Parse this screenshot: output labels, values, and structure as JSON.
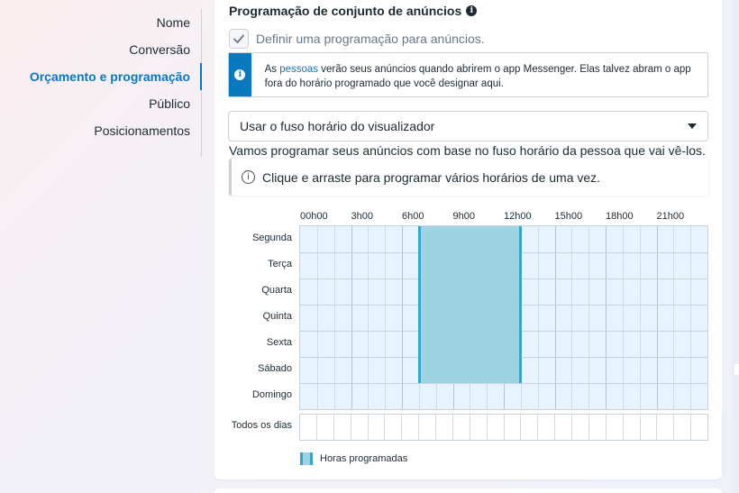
{
  "sidebar": {
    "items": [
      {
        "label": "Nome"
      },
      {
        "label": "Conversão"
      },
      {
        "label": "Orçamento e programação",
        "active": true
      },
      {
        "label": "Público"
      },
      {
        "label": "Posicionamentos"
      }
    ]
  },
  "section": {
    "title": "Programação de conjunto de anúncios",
    "checkbox_label": "Definir uma programação para anúncios.",
    "checkbox_checked": true
  },
  "notice": {
    "prefix": "As ",
    "link": "pessoas",
    "suffix": " verão seus anúncios quando abrirem o app Messenger. Elas talvez abram o app fora do horário programado que você designar aqui."
  },
  "timezone_select": {
    "value": "Usar o fuso horário do visualizador"
  },
  "description": "Vamos programar seus anúncios com base no fuso horário da pessoa que vai vê-los.",
  "hint": "Clique e arraste para programar vários horários de uma vez.",
  "schedule": {
    "hour_labels": [
      "00h00",
      "3h00",
      "6h00",
      "9h00",
      "12h00",
      "15h00",
      "18h00",
      "21h00"
    ],
    "days": [
      "Segunda",
      "Terça",
      "Quarta",
      "Quinta",
      "Sexta",
      "Sábado",
      "Domingo"
    ],
    "all_days_label": "Todos os dias",
    "legend_label": "Horas programadas",
    "scheduled_start_hour": 7,
    "scheduled_end_hour": 13,
    "scheduled_days": [
      "Segunda",
      "Terça",
      "Quarta",
      "Quinta",
      "Sexta",
      "Sábado"
    ]
  },
  "colors": {
    "accent": "#0a78be",
    "scheduled_fill": "#9dd3e3",
    "scheduled_border": "#3aa6c7",
    "grid_bg": "#e7f3fd"
  }
}
